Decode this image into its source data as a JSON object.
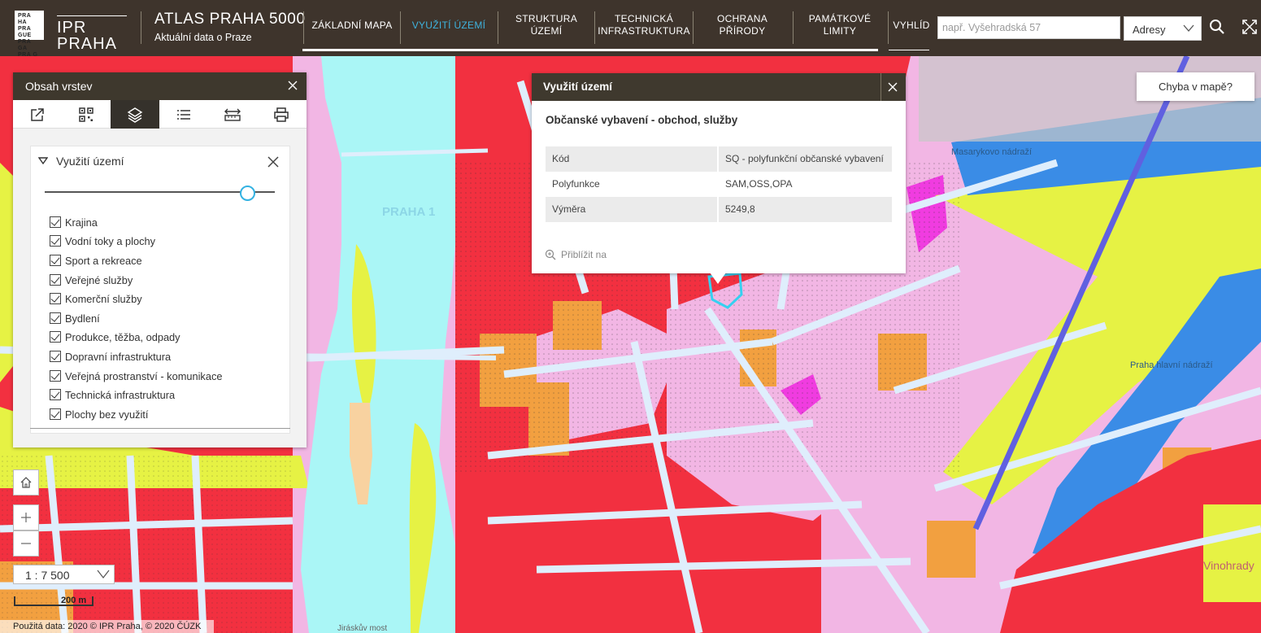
{
  "header": {
    "logo_box": "PRA HA PRA GUE PRA GA PRA G",
    "logo_text": "IPR PRAHA",
    "title": "ATLAS PRAHA 5000",
    "subtitle": "Aktuální data o Praze",
    "nav": [
      {
        "label": "ZÁKLADNÍ MAPA",
        "active": false
      },
      {
        "label": "VYUŽITÍ ÚZEMÍ",
        "active": true
      },
      {
        "label": "STRUKTURA ÚZEMÍ",
        "active": false
      },
      {
        "label": "TECHNICKÁ INFRASTRUKTURA",
        "active": false
      },
      {
        "label": "OCHRANA PŘÍRODY",
        "active": false
      },
      {
        "label": "PAMÁTKOVÉ LIMITY",
        "active": false
      },
      {
        "label": "VYHLÍD",
        "active": false
      }
    ],
    "search_placeholder": "např. Vyšehradská 57",
    "search_type": "Adresy",
    "accent_color": "#3fb3de"
  },
  "layers_panel": {
    "title": "Obsah vrstev",
    "tools": [
      "share-icon",
      "qr-code-icon",
      "layers-icon",
      "legend-list-icon",
      "measure-icon",
      "print-icon"
    ],
    "active_tool": "layers-icon",
    "group_title": "Využití území",
    "opacity_percent": 88,
    "layers": [
      {
        "label": "Krajina",
        "checked": true
      },
      {
        "label": "Vodní toky a plochy",
        "checked": true
      },
      {
        "label": "Sport a rekreace",
        "checked": true
      },
      {
        "label": "Veřejné služby",
        "checked": true
      },
      {
        "label": "Komerční služby",
        "checked": true
      },
      {
        "label": "Bydlení",
        "checked": true
      },
      {
        "label": "Produkce, těžba, odpady",
        "checked": true
      },
      {
        "label": "Dopravní infrastruktura",
        "checked": true
      },
      {
        "label": "Veřejná prostranství - komunikace",
        "checked": true
      },
      {
        "label": "Technická infrastruktura",
        "checked": true
      },
      {
        "label": "Plochy bez využití",
        "checked": true
      }
    ]
  },
  "popup": {
    "title": "Využití území",
    "feature_title": "Občanské vybavení - obchod, služby",
    "attributes": [
      {
        "key": "Kód",
        "value": "SQ - polyfunkční občanské vybavení"
      },
      {
        "key": "Polyfunkce",
        "value": "SAM,OSS,OPA"
      },
      {
        "key": "Výměra",
        "value": "5249,8"
      }
    ],
    "zoom_to_label": "Přiblížit na"
  },
  "map": {
    "report_error_label": "Chyba v mapě?",
    "scale": "1 : 7 500",
    "scalebar_label": "200 m",
    "attribution": "Použitá data: 2020 © IPR Praha, © 2020 ČÚZK",
    "labels": [
      "PRAHA 1",
      "Praha hlavní nádraží",
      "Vinohrady",
      "Masarykovo nádraží",
      "Jiráskův most"
    ],
    "colors": {
      "water": "#aaf6f6",
      "residential": "#f23040",
      "commercial": "#f2b6e4",
      "public_services": "#f2a040",
      "roads": "#ffffff",
      "greenery": "#e6f244",
      "transport": "#c8c8c8",
      "railway": "#3a8ce6"
    }
  }
}
